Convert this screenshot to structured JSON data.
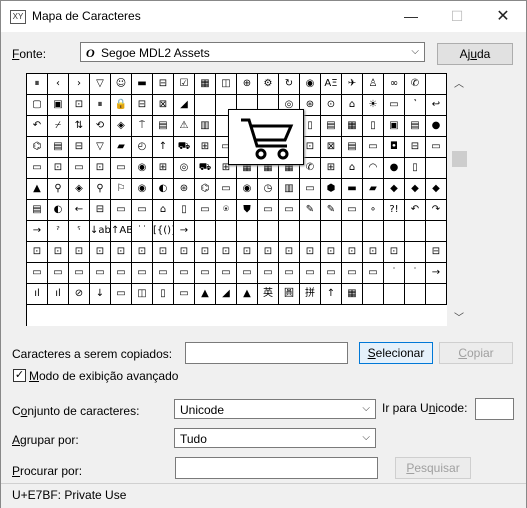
{
  "window": {
    "title": "Mapa de Caracteres",
    "minimize": "—",
    "maximize": "☐",
    "close": "✕",
    "app_icon": "XY"
  },
  "font": {
    "label_prefix": "F",
    "label_rest": "onte:",
    "icon": "O",
    "value": "Segoe MDL2 Assets",
    "arrow": "⌵"
  },
  "help_button": {
    "pre": "Aj",
    "u": "u",
    "post": "da"
  },
  "grid": {
    "cells": [
      "⏸",
      "‹",
      "›",
      "▽",
      "☺",
      "▬",
      "⊟",
      "☑",
      "▦",
      "◫",
      "⊕",
      "⚙",
      "↻",
      "◉",
      "AΞ",
      "✈",
      "♙",
      "∞",
      "✆",
      "",
      "▢",
      "▣",
      "⊡",
      "⏸",
      "🔒",
      "⊟",
      "⊠",
      "◢",
      "",
      "",
      "",
      "",
      "◎",
      "⊛",
      "⊙",
      "⌂",
      "☀",
      "▭",
      "˺",
      "↩",
      "↶",
      "⌿",
      "⇅",
      "⟲",
      "◈",
      "⍑",
      "▤",
      "⚠",
      "▥",
      "",
      "",
      "",
      "⊞",
      "▯",
      "▤",
      "▦",
      "▯",
      "▣",
      "▤",
      "●",
      "⌬",
      "▤",
      "⊟",
      "▽",
      "▰",
      "◴",
      "↑",
      "⛟",
      "⊞",
      "▭",
      "",
      "",
      "⌁",
      "⊡",
      "⊠",
      "▤",
      "▭",
      "◘",
      "⊟",
      "▭",
      "▭",
      "⊡",
      "▭",
      "⊡",
      "▭",
      "◉",
      "⊞",
      "◎",
      "⛟",
      "⊞",
      "▦",
      "▦",
      "▦",
      "✆",
      "⊞",
      "⌂",
      "◠",
      "●",
      "▯",
      "",
      "▲",
      "⚲",
      "◈",
      "⚲",
      "⚐",
      "◉",
      "◐",
      "⊛",
      "⌬",
      "▭",
      "◉",
      "◷",
      "▥",
      "▭",
      "⬢",
      "▬",
      "▰",
      "◆",
      "◆",
      "◆",
      "▤",
      "◐",
      "←",
      "⊟",
      "▭",
      "▭",
      "⌂",
      "▯",
      "▭",
      "⍟",
      "⛊",
      "▭",
      "▭",
      "✎",
      "✎",
      "▭",
      "∘",
      "?!",
      "↶",
      "↷",
      "→",
      "ˀ",
      "ˁ",
      "↓abc",
      "↑ABC",
      "˙˙",
      "[{()}]",
      "→",
      "",
      "",
      "",
      "",
      "",
      "",
      "",
      "",
      "",
      "",
      "",
      "",
      "⊡",
      "⊡",
      "⊡",
      "⊡",
      "⊡",
      "⊡",
      "⊡",
      "⊡",
      "⊡",
      "⊡",
      "⊡",
      "⊡",
      "⊡",
      "⊡",
      "⊡",
      "⊡",
      "⊡",
      "⊡",
      "",
      "⊟",
      "▭",
      "▭",
      "▭",
      "▭",
      "▭",
      "▭",
      "▭",
      "▭",
      "▭",
      "▭",
      "▭",
      "▭",
      "▭",
      "▭",
      "▭",
      "▭",
      "▭",
      "˙",
      "˙",
      "→",
      "ıl",
      "ıl",
      "⊘",
      "↓",
      "▭",
      "◫",
      "▯",
      "▭",
      "▲",
      "◢",
      "▲",
      "英",
      "圓",
      "拼",
      "↑",
      "▦",
      "",
      "",
      "",
      ""
    ],
    "enlarged_char": "cart-icon"
  },
  "copy": {
    "label": "Caracteres a serem copiados:",
    "value": "",
    "select_pre": "",
    "select_u": "S",
    "select_post": "elecionar",
    "copy_pre": "",
    "copy_u": "C",
    "copy_post": "opiar"
  },
  "advanced": {
    "checked": "✓",
    "label_u": "M",
    "label_rest": "odo de exibição avançado"
  },
  "charset": {
    "label_pre": "C",
    "label_u": "o",
    "label_post": "njunto de caracteres:",
    "value": "Unicode",
    "goto_pre": "Ir para U",
    "goto_u": "n",
    "goto_post": "icode:",
    "goto_value": ""
  },
  "group": {
    "label_pre": "",
    "label_u": "A",
    "label_post": "grupar por:",
    "value": "Tudo"
  },
  "search": {
    "label_pre": "",
    "label_u": "P",
    "label_post": "rocurar por:",
    "value": "",
    "button_pre": "",
    "button_u": "P",
    "button_post": "esquisar"
  },
  "status": "U+E7BF: Private Use"
}
